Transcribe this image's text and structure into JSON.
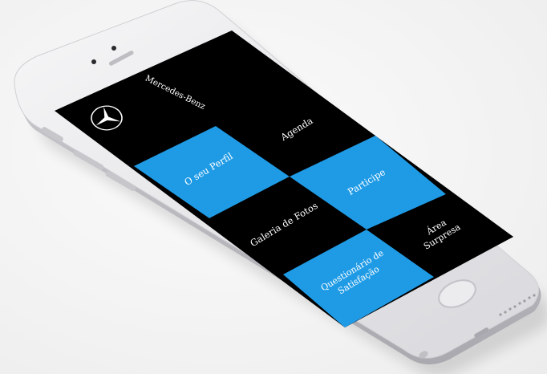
{
  "app": {
    "brand": "Mercedes-Benz",
    "logo_icon": "mercedes-star-icon"
  },
  "menu": [
    {
      "id": "perfil",
      "label": "O seu Perfil",
      "color": "#1f9be6"
    },
    {
      "id": "agenda",
      "label": "Agenda",
      "color": "#000000"
    },
    {
      "id": "galeria",
      "label": "Galeria de Fotos",
      "color": "#000000"
    },
    {
      "id": "participe",
      "label": "Participe",
      "color": "#1f9be6"
    },
    {
      "id": "questionario",
      "label_line1": "Questionário de",
      "label_line2": "Satisfação",
      "color": "#1f9be6"
    },
    {
      "id": "area",
      "label_line1": "Área",
      "label_line2": "Surpresa",
      "color": "#000000"
    }
  ],
  "colors": {
    "accent": "#1f9be6",
    "screen_bg": "#000000",
    "device_body": "#e9e9ec"
  }
}
